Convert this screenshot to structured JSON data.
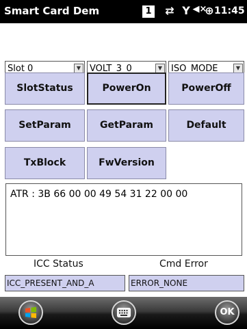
{
  "titlebar": {
    "title": "Smart Card Dem",
    "badge": "1",
    "sync_icon": "⇄",
    "signal_icon": "Y",
    "volume_icon": "◀×",
    "battery_icon": "⊕",
    "time": "11:45"
  },
  "dropdowns": [
    {
      "value": "Slot 0"
    },
    {
      "value": "VOLT_3_0"
    },
    {
      "value": "ISO_MODE"
    }
  ],
  "buttons": {
    "slot_status": "SlotStatus",
    "power_on": "PowerOn",
    "power_off": "PowerOff",
    "set_param": "SetParam",
    "get_param": "GetParam",
    "default": "Default",
    "tx_block": "TxBlock",
    "fw_version": "FwVersion"
  },
  "atr_text": "ATR : 3B 66 00 00 49 54 31 22 00 00",
  "status": {
    "icc_label": "ICC Status",
    "icc_value": "ICC_PRESENT_AND_A",
    "cmd_label": "Cmd Error",
    "cmd_value": "ERROR_NONE"
  },
  "bottombar": {
    "start_icon": "windows-logo",
    "keyboard_icon": "keyboard",
    "ok_label": "OK"
  }
}
